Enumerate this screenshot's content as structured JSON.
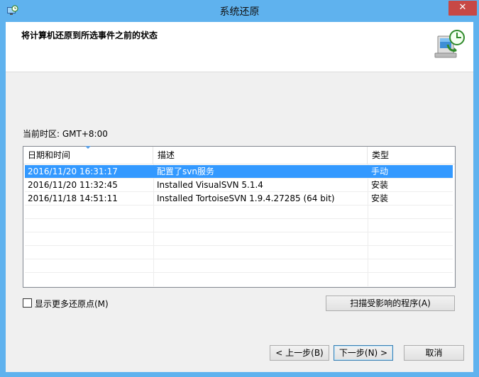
{
  "window": {
    "title": "系统还原",
    "close_glyph": "✕"
  },
  "header": {
    "title": "将计算机还原到所选事件之前的状态",
    "icon": "system-restore-icon"
  },
  "timezone": {
    "text": "当前时区: GMT+8:00"
  },
  "list": {
    "columns": [
      "日期和时间",
      "描述",
      "类型"
    ],
    "rows": [
      {
        "date": "2016/11/20 16:31:17",
        "description": "配置了svn服务",
        "type": "手动",
        "selected": true
      },
      {
        "date": "2016/11/20 11:32:45",
        "description": "Installed VisualSVN 5.1.4",
        "type": "安装",
        "selected": false
      },
      {
        "date": "2016/11/18 14:51:11",
        "description": "Installed TortoiseSVN 1.9.4.27285 (64 bit)",
        "type": "安装",
        "selected": false
      }
    ]
  },
  "show_more": {
    "label": "显示更多还原点(M)",
    "checked": false
  },
  "buttons": {
    "scan": "扫描受影响的程序(A)",
    "back": "< 上一步(B)",
    "next": "下一步(N) >",
    "cancel": "取消"
  },
  "colors": {
    "titlebar": "#5fb2ee",
    "selection": "#3399ff",
    "close": "#c74845"
  }
}
